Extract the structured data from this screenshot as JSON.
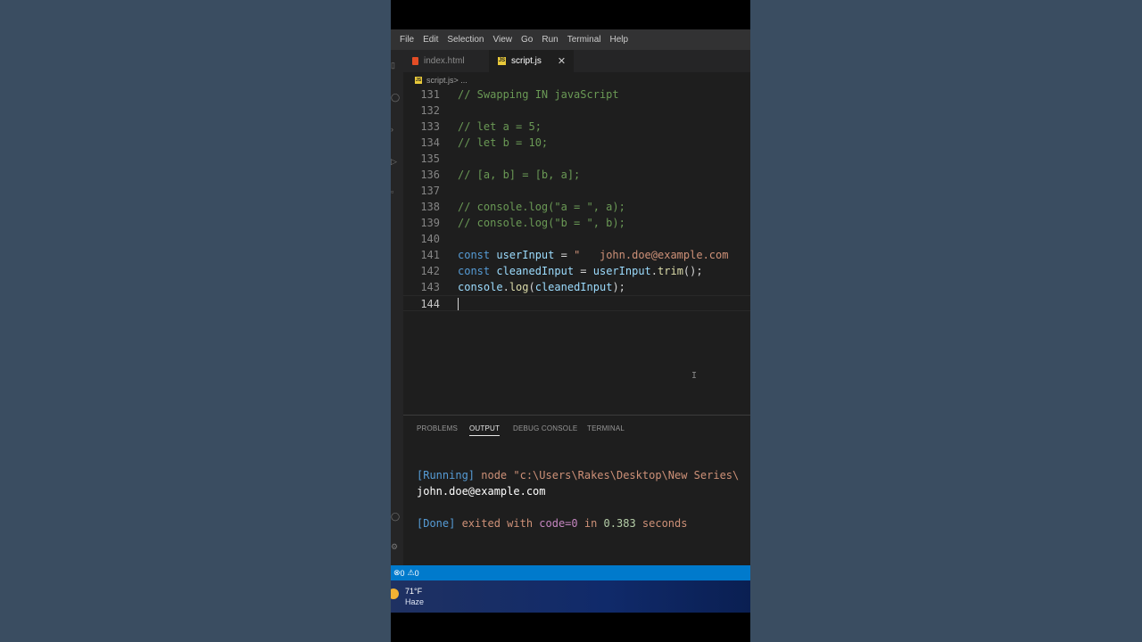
{
  "menu": [
    "File",
    "Edit",
    "Selection",
    "View",
    "Go",
    "Run",
    "Terminal",
    "Help"
  ],
  "tabs": [
    {
      "label": "index.html",
      "icon": "html-file-icon"
    },
    {
      "label": "script.js",
      "icon": "js-file-icon",
      "close": "✕"
    }
  ],
  "breadcrumb": {
    "file": "script.js",
    "rest": " > ..."
  },
  "editor": {
    "lines": [
      {
        "n": "131",
        "tokens": [
          {
            "t": "// Swapping IN javaScript",
            "c": "cmt"
          }
        ]
      },
      {
        "n": "132",
        "tokens": []
      },
      {
        "n": "133",
        "tokens": [
          {
            "t": "// let a = 5;",
            "c": "cmt"
          }
        ]
      },
      {
        "n": "134",
        "tokens": [
          {
            "t": "// let b = 10;",
            "c": "cmt"
          }
        ]
      },
      {
        "n": "135",
        "tokens": []
      },
      {
        "n": "136",
        "tokens": [
          {
            "t": "// [a, b] = [b, a];",
            "c": "cmt"
          }
        ]
      },
      {
        "n": "137",
        "tokens": []
      },
      {
        "n": "138",
        "tokens": [
          {
            "t": "// console.log(\"a = \", a);",
            "c": "cmt"
          }
        ]
      },
      {
        "n": "139",
        "tokens": [
          {
            "t": "// console.log(\"b = \", b);",
            "c": "cmt"
          }
        ]
      },
      {
        "n": "140",
        "tokens": []
      },
      {
        "n": "141",
        "tokens": [
          {
            "t": "const ",
            "c": "kw"
          },
          {
            "t": "userInput",
            "c": "var"
          },
          {
            "t": " = ",
            "c": "pl"
          },
          {
            "t": "\"   john.doe@example.com",
            "c": "str"
          }
        ]
      },
      {
        "n": "142",
        "tokens": [
          {
            "t": "const ",
            "c": "kw"
          },
          {
            "t": "cleanedInput",
            "c": "var"
          },
          {
            "t": " = ",
            "c": "pl"
          },
          {
            "t": "userInput",
            "c": "var"
          },
          {
            "t": ".",
            "c": "pl"
          },
          {
            "t": "trim",
            "c": "fn"
          },
          {
            "t": "();",
            "c": "pl"
          }
        ]
      },
      {
        "n": "143",
        "tokens": [
          {
            "t": "console",
            "c": "var"
          },
          {
            "t": ".",
            "c": "pl"
          },
          {
            "t": "log",
            "c": "fn"
          },
          {
            "t": "(",
            "c": "pl"
          },
          {
            "t": "cleanedInput",
            "c": "var"
          },
          {
            "t": ");",
            "c": "pl"
          }
        ]
      },
      {
        "n": "144",
        "tokens": [],
        "current": true
      }
    ]
  },
  "panel": {
    "tabs": [
      "PROBLEMS",
      "OUTPUT",
      "DEBUG CONSOLE",
      "TERMINAL"
    ],
    "active_tab": "OUTPUT",
    "output": {
      "running_tag": "[Running]",
      "running_cmd": " node \"c:\\Users\\Rakes\\Desktop\\New Series\\",
      "result": "john.doe@example.com",
      "done_tag": "[Done]",
      "done_text1": " exited with ",
      "done_code": "code=0",
      "done_text2": " in ",
      "done_time": "0.383",
      "done_text3": " seconds"
    }
  },
  "status": {
    "errors": "0",
    "warnings": "0"
  },
  "taskbar": {
    "temp": "71°F",
    "condition": "Haze"
  },
  "colors": {
    "statusbar": "#007acc",
    "editor_bg": "#1e1e1e",
    "comment": "#6a9955",
    "keyword": "#569cd6"
  }
}
